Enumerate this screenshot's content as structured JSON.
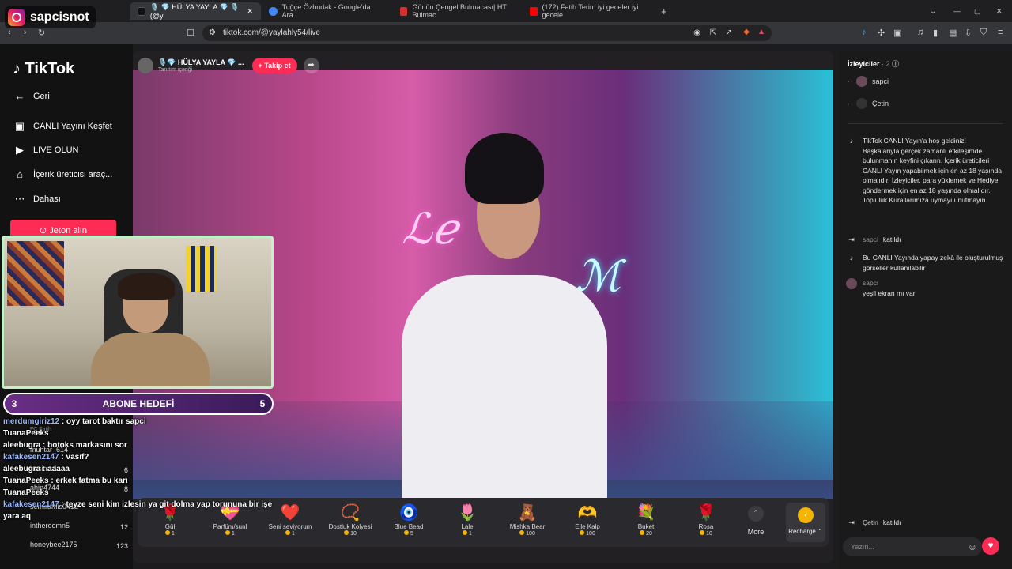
{
  "browser": {
    "tabs": [
      {
        "label": "🎙️ 💎 HÜLYA YAYLA 💎 🎙️ (@y",
        "active": true,
        "color": "#111111"
      },
      {
        "label": "Tuğçe Özbudak - Google'da Ara",
        "active": false,
        "color": "#4285f4"
      },
      {
        "label": "Günün Çengel Bulmacası| HT Bulmac",
        "active": false,
        "color": "#d32f2f"
      },
      {
        "label": "(172) Fatih Terim iyi geceler iyi gecele",
        "active": false,
        "color": "#ff0000"
      }
    ],
    "new_tab": "+",
    "url": "tiktok.com/@yaylahly54/live",
    "window_controls": [
      "⌄",
      "—",
      "▢",
      "✕"
    ]
  },
  "sidebar": {
    "logo": "TikTok",
    "items": [
      {
        "icon": "arrow-left-icon",
        "glyph": "←",
        "label": "Geri"
      },
      {
        "icon": "live-explore-icon",
        "glyph": "▣",
        "label": "CANLI Yayını Keşfet"
      },
      {
        "icon": "camera-icon",
        "glyph": "▶",
        "label": "LIVE OLUN"
      },
      {
        "icon": "creator-tools-icon",
        "glyph": "⌂",
        "label": "İçerik üreticisi araç..."
      },
      {
        "icon": "more-icon",
        "glyph": "⋯",
        "label": "Dahası"
      }
    ],
    "jeton_button": "Jeton alın"
  },
  "stream": {
    "host_name": "🎙️💎 HÜLYA YAYLA 💎 ...",
    "host_sub": "Tanıtım içeriği",
    "follow_label": "+ Takip et",
    "share_glyph": "➦",
    "neon_left": "ℒℯ",
    "neon_right": "ℳ"
  },
  "gifts": [
    {
      "name": "Gül",
      "price": "1",
      "glyph": "🌹"
    },
    {
      "name": "Parfüm/sunl",
      "price": "1",
      "glyph": "💝"
    },
    {
      "name": "Seni seviyorum",
      "price": "1",
      "glyph": "❤️"
    },
    {
      "name": "Dostluk Kolyesi",
      "price": "10",
      "glyph": "📿"
    },
    {
      "name": "Blue Bead",
      "price": "5",
      "glyph": "🧿"
    },
    {
      "name": "Lale",
      "price": "1",
      "glyph": "🌷"
    },
    {
      "name": "Mishka Bear",
      "price": "100",
      "glyph": "🧸"
    },
    {
      "name": "Elle Kalp",
      "price": "100",
      "glyph": "🫶"
    },
    {
      "name": "Buket",
      "price": "20",
      "glyph": "💐"
    },
    {
      "name": "Rosa",
      "price": "10",
      "glyph": "🌹"
    }
  ],
  "gift_more": "More",
  "recharge": "Recharge ⌃",
  "right_panel": {
    "viewers_label": "İzleyiciler",
    "viewers_count": "· 2",
    "viewers": [
      "sapci",
      "Çetin"
    ],
    "messages": [
      {
        "type": "system",
        "icon": "tiktok-icon",
        "user": "",
        "text": "TikTok CANLI Yayın'a hoş geldiniz! Başkalarıyla gerçek zamanlı etkileşimde bulunmanın keyfini çıkarın. İçerik üreticileri CANLI Yayın yapabilmek için en az 18 yaşında olmalıdır. İzleyiciler, para yüklemek ve Hediye göndermek için en az 18 yaşında olmalıdır. Topluluk Kurallarımıza uymayı unutmayın."
      },
      {
        "type": "join",
        "icon": "join-icon",
        "user": "sapci",
        "text": "katıldı"
      },
      {
        "type": "system",
        "icon": "tiktok-icon",
        "user": "",
        "text": "Bu CANLI Yayında yapay zekâ ile oluşturulmuş görseller kullanılabilir"
      },
      {
        "type": "chat",
        "icon": "avatar-icon",
        "user": "sapci",
        "text": "yeşil ekran mı var"
      }
    ],
    "bottom_join": {
      "user": "Çetin",
      "text": "katıldı"
    },
    "input_placeholder": "Yazın...",
    "emoji_glyph": "☺",
    "heart_glyph": "♥"
  },
  "streamer_overlay": {
    "ig_handle": "sapcisnot",
    "abone_label": "ABONE HEDEFİ",
    "abone_current": "3",
    "abone_target": "5",
    "leaderboard": [
      {
        "name": "FC Fatih",
        "count": ""
      },
      {
        "name": "muhtar_614",
        "count": ""
      },
      {
        "name": "hesinaal",
        "count": "6"
      },
      {
        "name": "ahin4744",
        "count": "8"
      },
      {
        "name": "semiramis0412",
        "count": ""
      },
      {
        "name": "intheroomn5",
        "count": "12"
      },
      {
        "name": "honeybee2175",
        "count": "123"
      }
    ],
    "chat": [
      {
        "user": "merdumgiriz12",
        "text": ": oyy tarot baktır sapci"
      },
      {
        "user": "TuanaPeeks",
        "text": ""
      },
      {
        "user": "aleebugra",
        "text": ": botoks markasını sor"
      },
      {
        "user": "kafakesen2147",
        "text": ": vasıf?"
      },
      {
        "user": "aleebugra",
        "text": ": aaaaa"
      },
      {
        "user": "TuanaPeeks",
        "text": ": erkek fatma bu karı"
      },
      {
        "user": "TuanaPeeks",
        "text": ""
      },
      {
        "user": "kafakesen2147",
        "text": ": teyze seni kim izlesin ya git dolma yap torununa bir işe"
      },
      {
        "user": "yara aq",
        "text": ""
      }
    ]
  }
}
